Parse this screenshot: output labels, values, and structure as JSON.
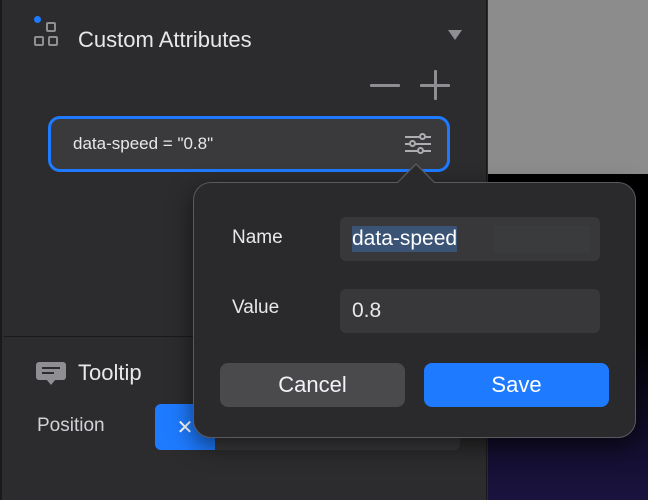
{
  "custom_attributes": {
    "title": "Custom Attributes",
    "attribute_row": "data-speed = \"0.8\""
  },
  "tooltip": {
    "title": "Tooltip",
    "position_label": "Position",
    "clear_glyph": "✕"
  },
  "popover": {
    "name_label": "Name",
    "name_value": "data-speed",
    "value_label": "Value",
    "value_value": "0.8",
    "cancel_label": "Cancel",
    "save_label": "Save"
  },
  "colors": {
    "accent": "#1e7bff",
    "panel_bg": "#2c2c2e",
    "selection": "#3b5476"
  }
}
